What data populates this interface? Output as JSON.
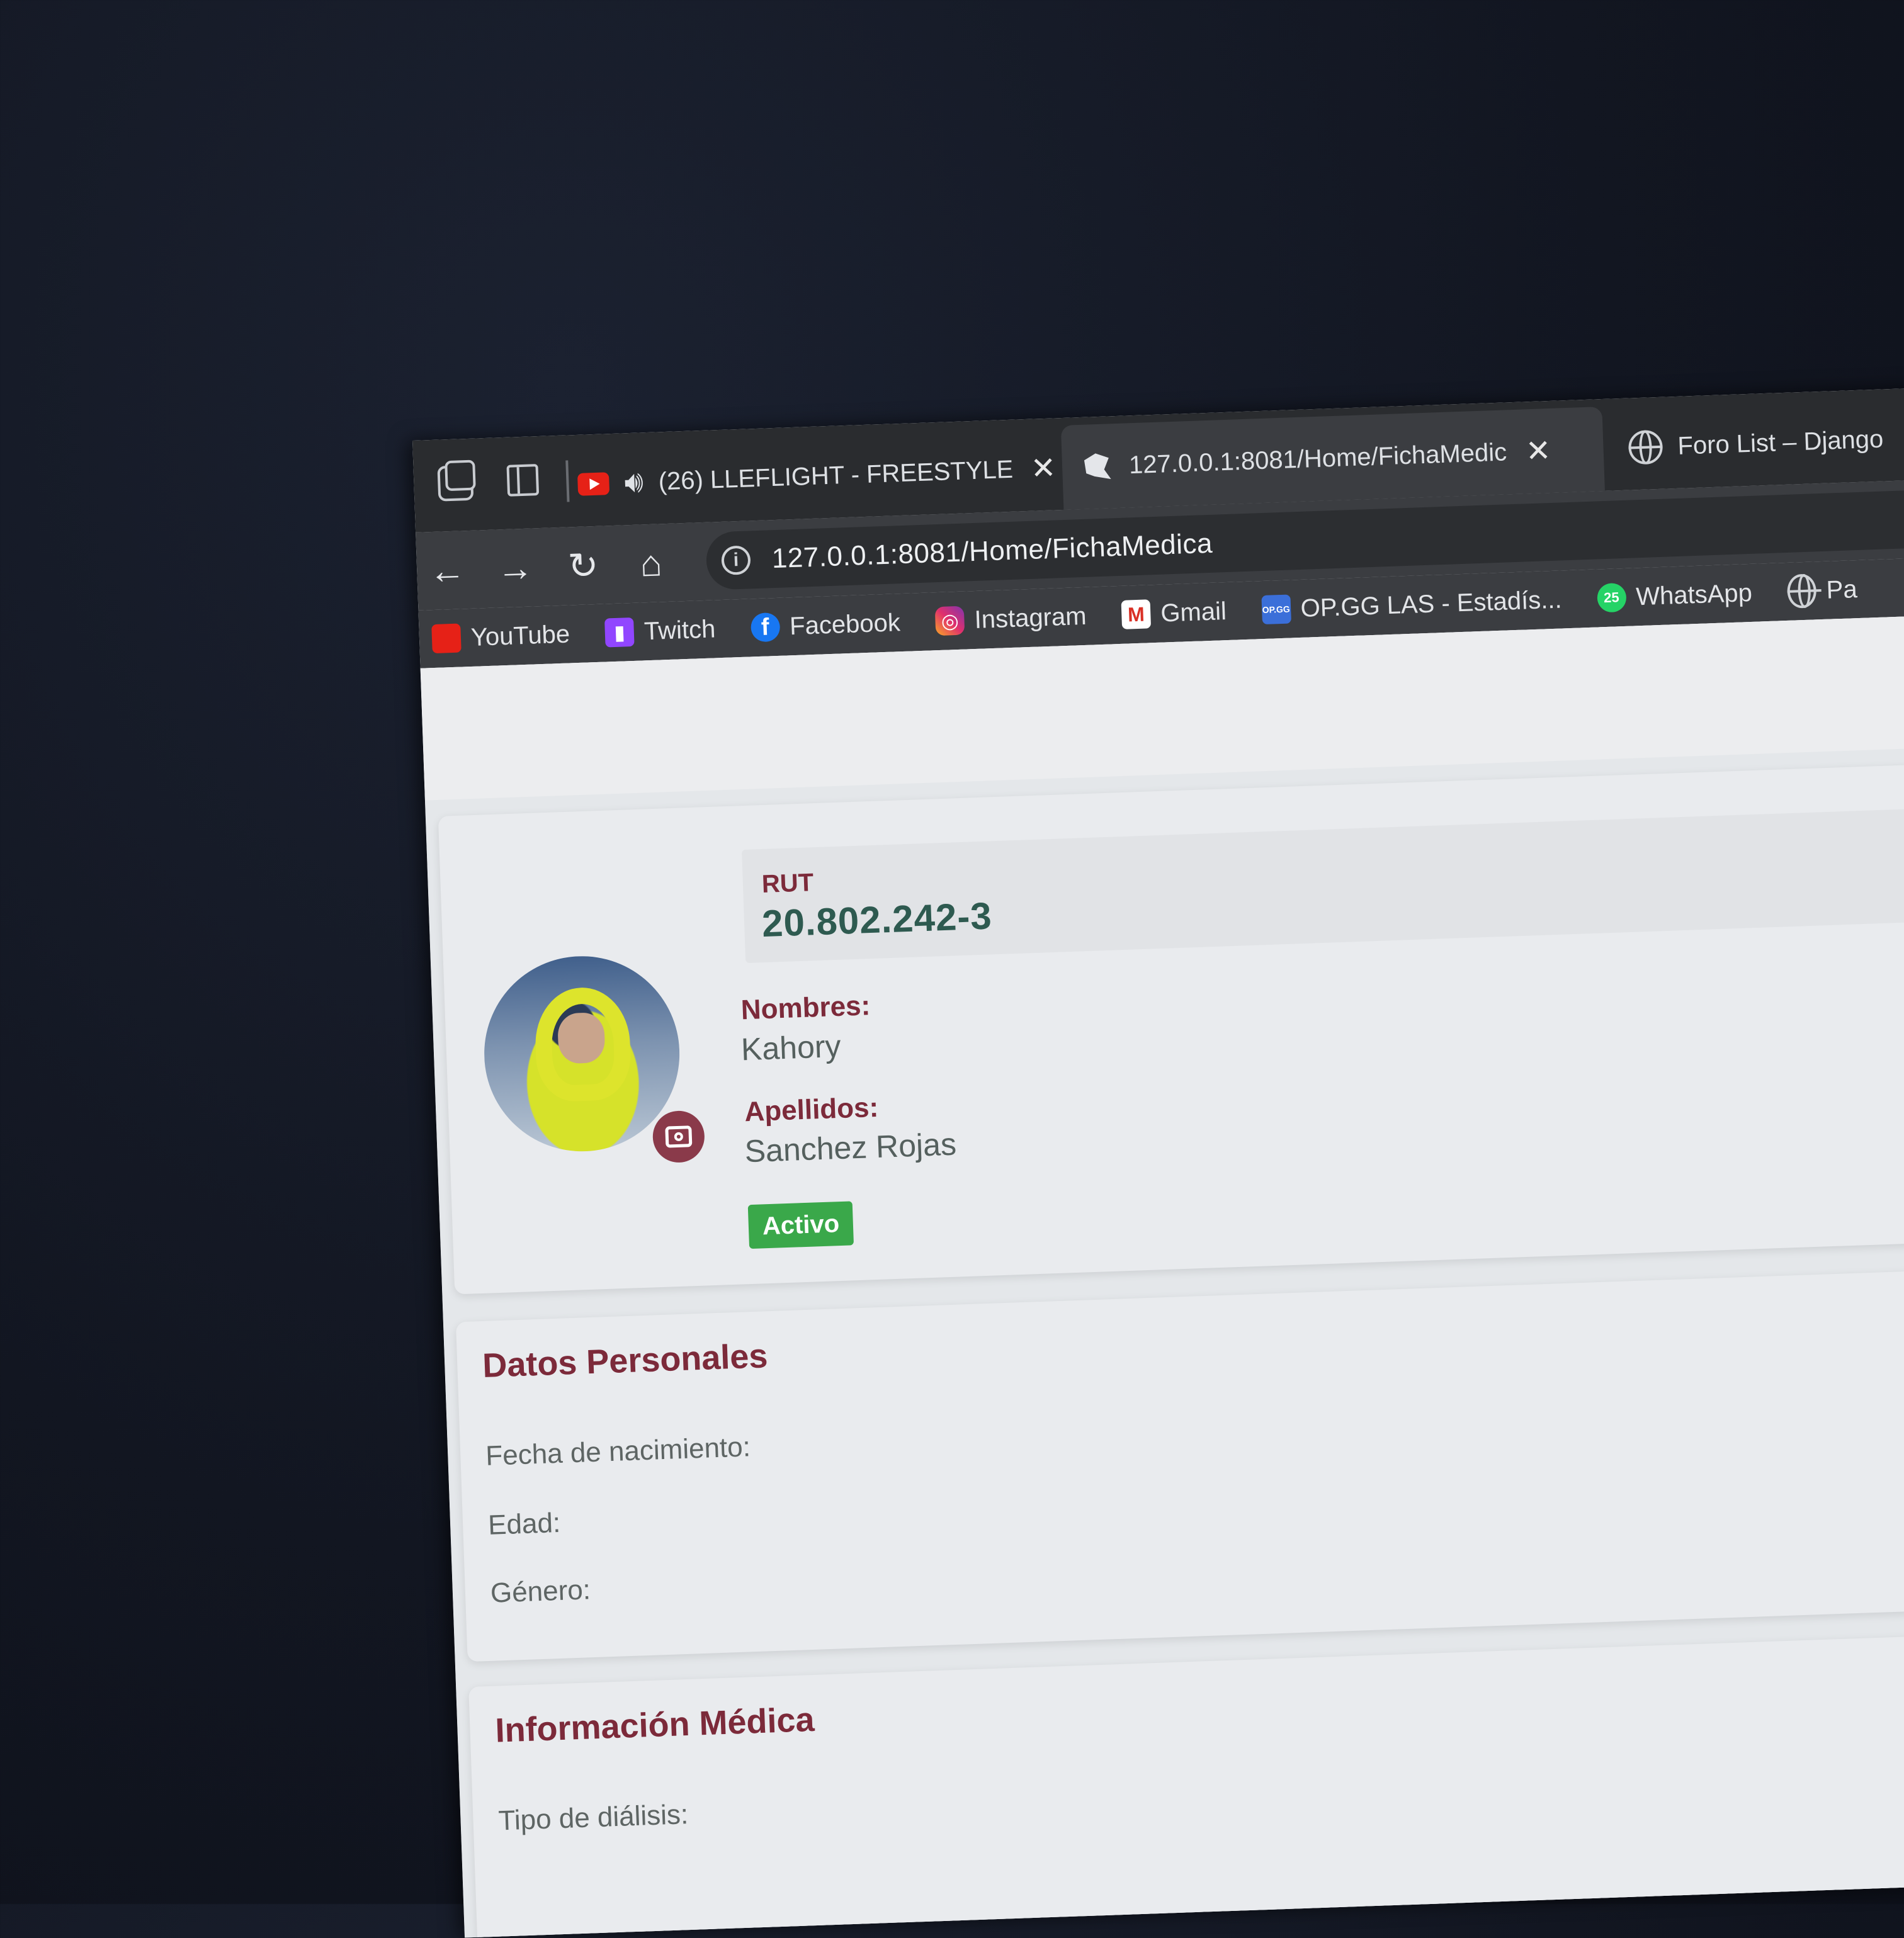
{
  "tabs": [
    {
      "label": "(26) LLEFLIGHT - FREESTYLE",
      "icon": "youtube-icon",
      "close": "✕"
    },
    {
      "label": "127.0.0.1:8081/Home/FichaMedic",
      "icon": "django-icon",
      "close": "✕"
    },
    {
      "label": "Foro List – Django",
      "icon": "globe-icon"
    }
  ],
  "toolbar": {
    "url": "127.0.0.1:8081/Home/FichaMedica"
  },
  "bookmarks": [
    {
      "label": "YouTube",
      "icon": "youtube-icon",
      "glyph": ""
    },
    {
      "label": "Twitch",
      "icon": "twitch-icon",
      "glyph": "▮"
    },
    {
      "label": "Facebook",
      "icon": "facebook-icon",
      "glyph": "f"
    },
    {
      "label": "Instagram",
      "icon": "instagram-icon",
      "glyph": "◎"
    },
    {
      "label": "Gmail",
      "icon": "gmail-icon",
      "glyph": "M"
    },
    {
      "label": "OP.GG LAS - Estadís...",
      "icon": "opgg-icon",
      "glyph": "OP.GG"
    },
    {
      "label": "WhatsApp",
      "icon": "whatsapp-icon",
      "glyph": "25"
    },
    {
      "label": "Pa",
      "icon": "globe-icon",
      "glyph": ""
    }
  ],
  "profile": {
    "rut_label": "RUT",
    "rut_value": "20.802.242-3",
    "nombres_label": "Nombres:",
    "nombres_value": "Kahory",
    "apellidos_label": "Apellidos:",
    "apellidos_value": "Sanchez Rojas",
    "status": "Activo",
    "status_color": "#3aa84a"
  },
  "personal": {
    "title": "Datos Personales",
    "fecha_label": "Fecha de nacimiento:",
    "edad_label": "Edad:",
    "genero_label": "Género:"
  },
  "medical": {
    "title": "Información Médica",
    "tipo_label": "Tipo de diálisis:"
  },
  "colors": {
    "accent": "#7c2a3a",
    "rut": "#2e5a50"
  }
}
